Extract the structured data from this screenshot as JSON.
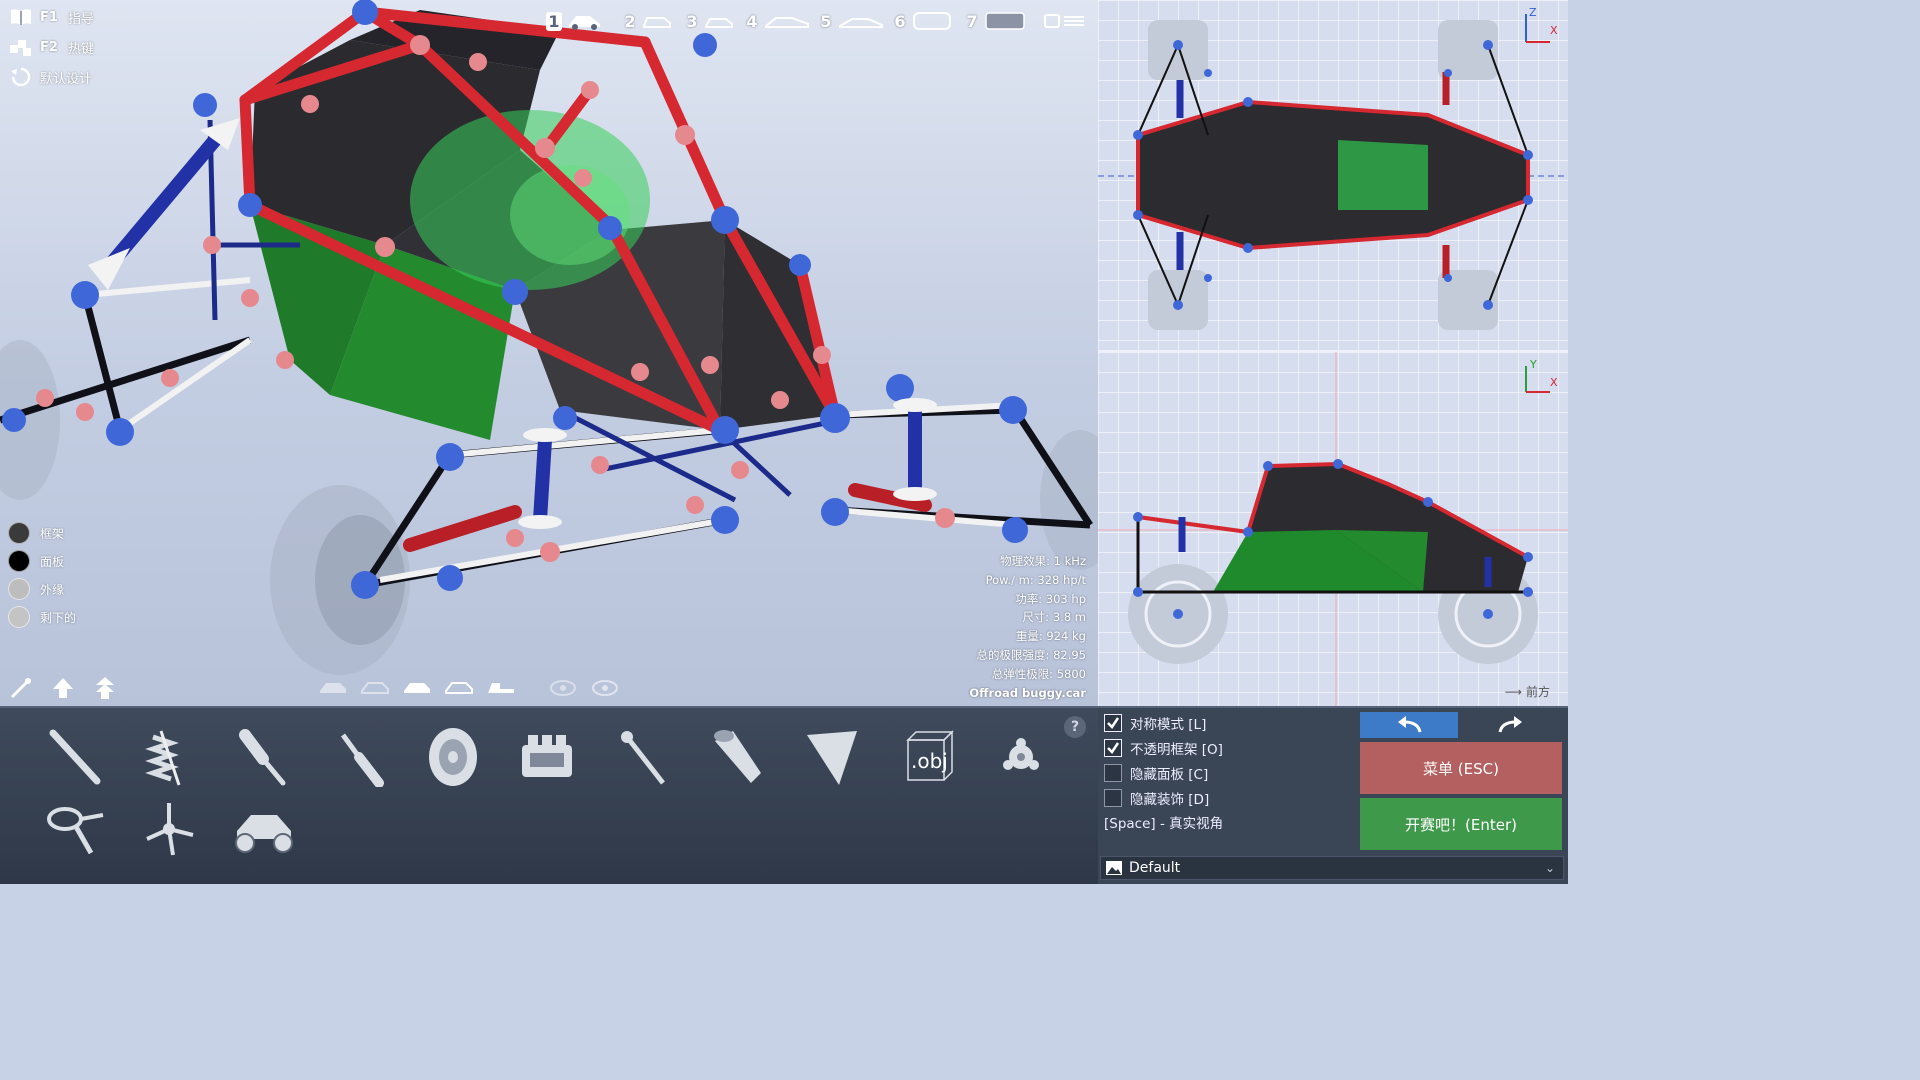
{
  "help": [
    {
      "key": "F1",
      "label": "指导",
      "icon": "book-icon"
    },
    {
      "key": "F2",
      "label": "热键",
      "icon": "keys-icon"
    },
    {
      "key": "",
      "label": "默认设计",
      "icon": "reset-icon"
    }
  ],
  "car_presets": [
    {
      "num": "1",
      "icon": "buggy-icon",
      "active": true
    },
    {
      "num": "2",
      "icon": "hatchback-icon"
    },
    {
      "num": "3",
      "icon": "sedan-icon"
    },
    {
      "num": "4",
      "icon": "coupe-icon"
    },
    {
      "num": "5",
      "icon": "sportscar-icon"
    },
    {
      "num": "6",
      "icon": "van-icon"
    },
    {
      "num": "7",
      "icon": "truck-icon"
    }
  ],
  "legend": [
    {
      "label": "框架",
      "color": "#3a3a3a"
    },
    {
      "label": "面板",
      "color": "#000000"
    },
    {
      "label": "外缘",
      "color": "#bdbdbd"
    },
    {
      "label": "剩下的",
      "color": "#c4c4c4"
    }
  ],
  "stats": [
    {
      "label": "物理效果:",
      "value": "1 kHz"
    },
    {
      "label": "Pow./ m:",
      "value": "328 hp/t"
    },
    {
      "label": "功率:",
      "value": "303 hp"
    },
    {
      "label": "尺寸:",
      "value": "3.8 m"
    },
    {
      "label": "重量:",
      "value": "924 kg"
    },
    {
      "label": "总的极限强度:",
      "value": "82.95"
    },
    {
      "label": "总弹性极限:",
      "value": "5800"
    }
  ],
  "filename": "Offroad buggy.car",
  "axes": {
    "top_up": "Z",
    "top_right": "X",
    "front_up": "Y",
    "front_right": "X"
  },
  "front_label": "前方",
  "options": [
    {
      "label": "对称模式 [L]",
      "checked": true
    },
    {
      "label": "不透明框架 [O]",
      "checked": true
    },
    {
      "label": "隐藏面板 [C]",
      "checked": false
    },
    {
      "label": "隐藏装饰 [D]",
      "checked": false
    }
  ],
  "space_hint": "[Space] - 真实视角",
  "menu_button": "菜单 (ESC)",
  "start_button": "开赛吧！(Enter)",
  "preset": "Default",
  "help_button": "?",
  "obj_label": ".obj",
  "colors": {
    "frame_red": "#d62830",
    "node_blue": "#3f67d8",
    "panel_green": "#1f8a2c",
    "menu_red": "#b56060",
    "start_green": "#3e9a4a",
    "undo_blue": "#3d7ac8"
  }
}
